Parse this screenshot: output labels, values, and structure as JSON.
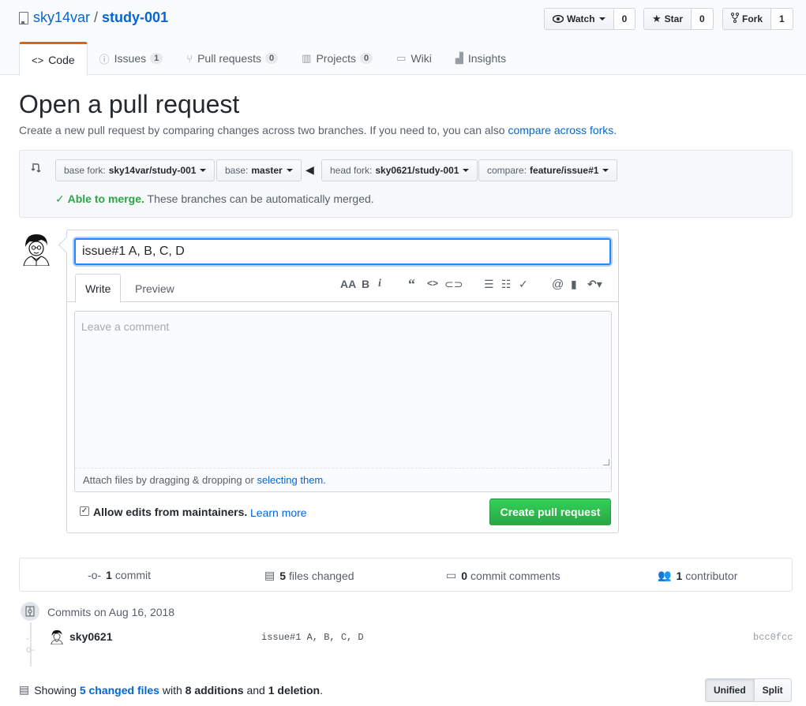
{
  "repo": {
    "owner": "sky14var",
    "separator": "/",
    "name": "study-001"
  },
  "actions": {
    "watch_label": "Watch",
    "watch_count": "0",
    "star_label": "Star",
    "star_count": "0",
    "fork_label": "Fork",
    "fork_count": "1"
  },
  "tabs": {
    "code": "Code",
    "issues": "Issues",
    "issues_count": "1",
    "pulls": "Pull requests",
    "pulls_count": "0",
    "projects": "Projects",
    "projects_count": "0",
    "wiki": "Wiki",
    "insights": "Insights"
  },
  "page": {
    "title": "Open a pull request",
    "subtitle": "Create a new pull request by comparing changes across two branches. If you need to, you can also",
    "subtitle_link": "compare across forks."
  },
  "range": {
    "base_fork_label": "base fork:",
    "base_fork_value": "sky14var/study-001",
    "base_label": "base:",
    "base_value": "master",
    "head_fork_label": "head fork:",
    "head_fork_value": "sky0621/study-001",
    "compare_label": "compare:",
    "compare_value": "feature/issue#1",
    "merge_ok": "Able to merge.",
    "merge_text": "These branches can be automatically merged."
  },
  "form": {
    "title_value": "issue#1 A, B, C, D",
    "write_tab": "Write",
    "preview_tab": "Preview",
    "comment_placeholder": "Leave a comment",
    "attach_text": "Attach files by dragging & dropping or",
    "attach_link": "selecting them.",
    "allow_edits": "Allow edits from maintainers.",
    "allow_edits_checked": true,
    "learn_more": "Learn more",
    "submit": "Create pull request"
  },
  "summary": {
    "commits_count": "1",
    "commits_label": "commit",
    "files_count": "5",
    "files_label": "files changed",
    "comments_count": "0",
    "comments_label": "commit comments",
    "contributors_count": "1",
    "contributors_label": "contributor"
  },
  "commits": {
    "date_heading": "Commits on Aug 16, 2018",
    "items": [
      {
        "author": "sky0621",
        "message": "issue#1 A, B, C, D",
        "sha": "bcc0fcc"
      }
    ]
  },
  "diffstat": {
    "showing": "Showing",
    "changed_files": "5 changed files",
    "with": "with",
    "additions": "8 additions",
    "and": "and",
    "deletions": "1 deletion",
    "period": "."
  },
  "view_toggle": {
    "unified": "Unified",
    "split": "Split"
  },
  "colors": {
    "link": "#0366d6",
    "success": "#28a745",
    "tab_accent": "#e36209",
    "focus": "#2188ff"
  },
  "icons": [
    "repo-icon",
    "eye-icon",
    "star-icon",
    "fork-icon",
    "code-icon",
    "issue-icon",
    "pull-request-icon",
    "project-icon",
    "book-icon",
    "graph-icon",
    "compare-icon",
    "arrow-left-icon",
    "check-icon",
    "text-size-icon",
    "bold-icon",
    "italic-icon",
    "quote-icon",
    "code-icon",
    "link-icon",
    "list-unordered-icon",
    "list-ordered-icon",
    "tasklist-icon",
    "mention-icon",
    "bookmark-icon",
    "reply-icon",
    "git-commit-icon",
    "file-diff-icon",
    "comment-icon",
    "people-icon"
  ]
}
